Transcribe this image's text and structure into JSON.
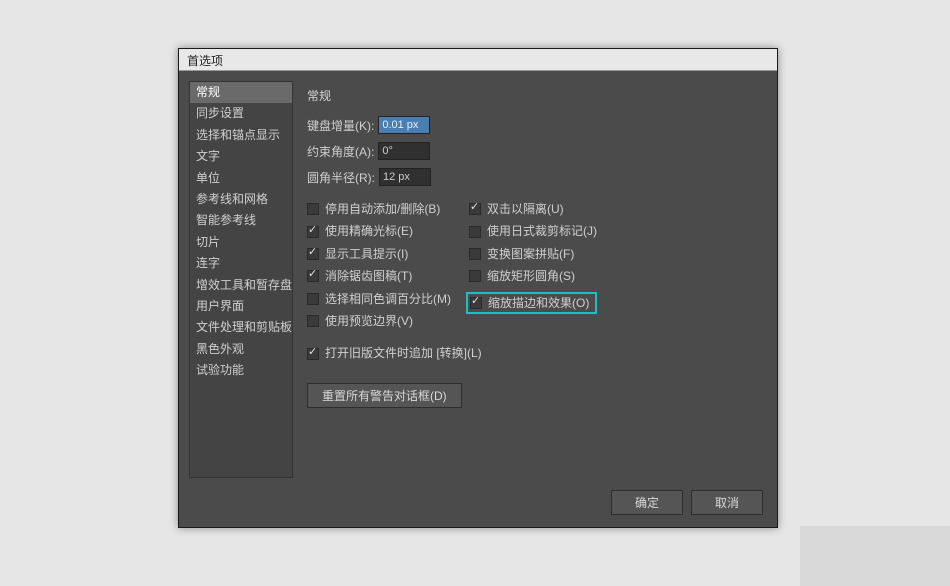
{
  "dialog": {
    "title": "首选项"
  },
  "sidebar": {
    "items": [
      "常规",
      "同步设置",
      "选择和锚点显示",
      "文字",
      "单位",
      "参考线和网格",
      "智能参考线",
      "切片",
      "连字",
      "增效工具和暂存盘",
      "用户界面",
      "文件处理和剪贴板",
      "黑色外观",
      "试验功能"
    ],
    "selected_index": 0
  },
  "content": {
    "section_title": "常规",
    "fields": {
      "keyboard_increment_label": "键盘增量(K):",
      "keyboard_increment_value": "0.01 px",
      "constrain_angle_label": "约束角度(A):",
      "constrain_angle_value": "0°",
      "corner_radius_label": "圆角半径(R):",
      "corner_radius_value": "12 px"
    },
    "checks_left": [
      {
        "label": "停用自动添加/删除(B)",
        "checked": false
      },
      {
        "label": "使用精确光标(E)",
        "checked": true
      },
      {
        "label": "显示工具提示(I)",
        "checked": true
      },
      {
        "label": "消除锯齿图稿(T)",
        "checked": true
      },
      {
        "label": "选择相同色调百分比(M)",
        "checked": false
      },
      {
        "label": "使用预览边界(V)",
        "checked": false
      }
    ],
    "checks_right": [
      {
        "label": "双击以隔离(U)",
        "checked": true
      },
      {
        "label": "使用日式裁剪标记(J)",
        "checked": false
      },
      {
        "label": "变换图案拼贴(F)",
        "checked": false
      },
      {
        "label": "缩放矩形圆角(S)",
        "checked": false
      },
      {
        "label": "缩放描边和效果(O)",
        "checked": true,
        "highlight": true
      }
    ],
    "extra_check": {
      "label": "打开旧版文件时追加 [转换](L)",
      "checked": true
    },
    "reset_button": "重置所有警告对话框(D)"
  },
  "buttons": {
    "ok": "确定",
    "cancel": "取消"
  }
}
